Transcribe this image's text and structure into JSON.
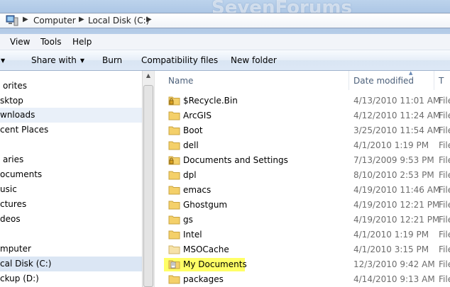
{
  "address": {
    "watermark": "SevenForums",
    "crumbs": [
      "Computer",
      "Local Disk (C:)"
    ],
    "icon": "computer-icon"
  },
  "menu": {
    "items": [
      "View",
      "Tools",
      "Help"
    ]
  },
  "toolbar": {
    "items": [
      "Share with",
      "Burn",
      "Compatibility files",
      "New folder"
    ]
  },
  "nav": {
    "items": [
      "orites",
      "sktop",
      "wnloads",
      "cent Places",
      "aries",
      "ocuments",
      "usic",
      "ctures",
      "deos",
      "mputer",
      "cal Disk (C:)",
      "ckup (D:)"
    ]
  },
  "columns": {
    "name": "Name",
    "date": "Date modified",
    "type": "T"
  },
  "files": [
    {
      "name": "$Recycle.Bin",
      "date": "4/13/2010 11:01 AM",
      "type": "File",
      "icon": "locked-folder-icon"
    },
    {
      "name": "ArcGIS",
      "date": "4/12/2010 11:24 AM",
      "type": "File",
      "icon": "folder-icon"
    },
    {
      "name": "Boot",
      "date": "3/25/2010 11:54 AM",
      "type": "File",
      "icon": "folder-icon"
    },
    {
      "name": "dell",
      "date": "4/1/2010 1:19 PM",
      "type": "File",
      "icon": "folder-icon"
    },
    {
      "name": "Documents and Settings",
      "date": "7/13/2009 9:53 PM",
      "type": "File",
      "icon": "locked-folder-icon"
    },
    {
      "name": "dpl",
      "date": "8/10/2010 2:53 PM",
      "type": "File",
      "icon": "folder-icon"
    },
    {
      "name": "emacs",
      "date": "4/19/2010 11:46 AM",
      "type": "File",
      "icon": "folder-icon"
    },
    {
      "name": "Ghostgum",
      "date": "4/19/2010 12:21 PM",
      "type": "File",
      "icon": "folder-icon"
    },
    {
      "name": "gs",
      "date": "4/19/2010 12:21 PM",
      "type": "File",
      "icon": "folder-icon"
    },
    {
      "name": "Intel",
      "date": "4/1/2010 1:19 PM",
      "type": "File",
      "icon": "folder-icon"
    },
    {
      "name": "MSOCache",
      "date": "4/1/2010 3:15 PM",
      "type": "File",
      "icon": "folder-icon"
    },
    {
      "name": "My Documents",
      "date": "12/3/2010 9:42 AM",
      "type": "File",
      "icon": "documents-folder-icon"
    },
    {
      "name": "packages",
      "date": "4/14/2010 9:13 AM",
      "type": "File",
      "icon": "folder-icon"
    }
  ],
  "colors": {
    "highlight": "#ffff66",
    "folder": "#f4d06a",
    "selection": "#dbe6f4"
  }
}
